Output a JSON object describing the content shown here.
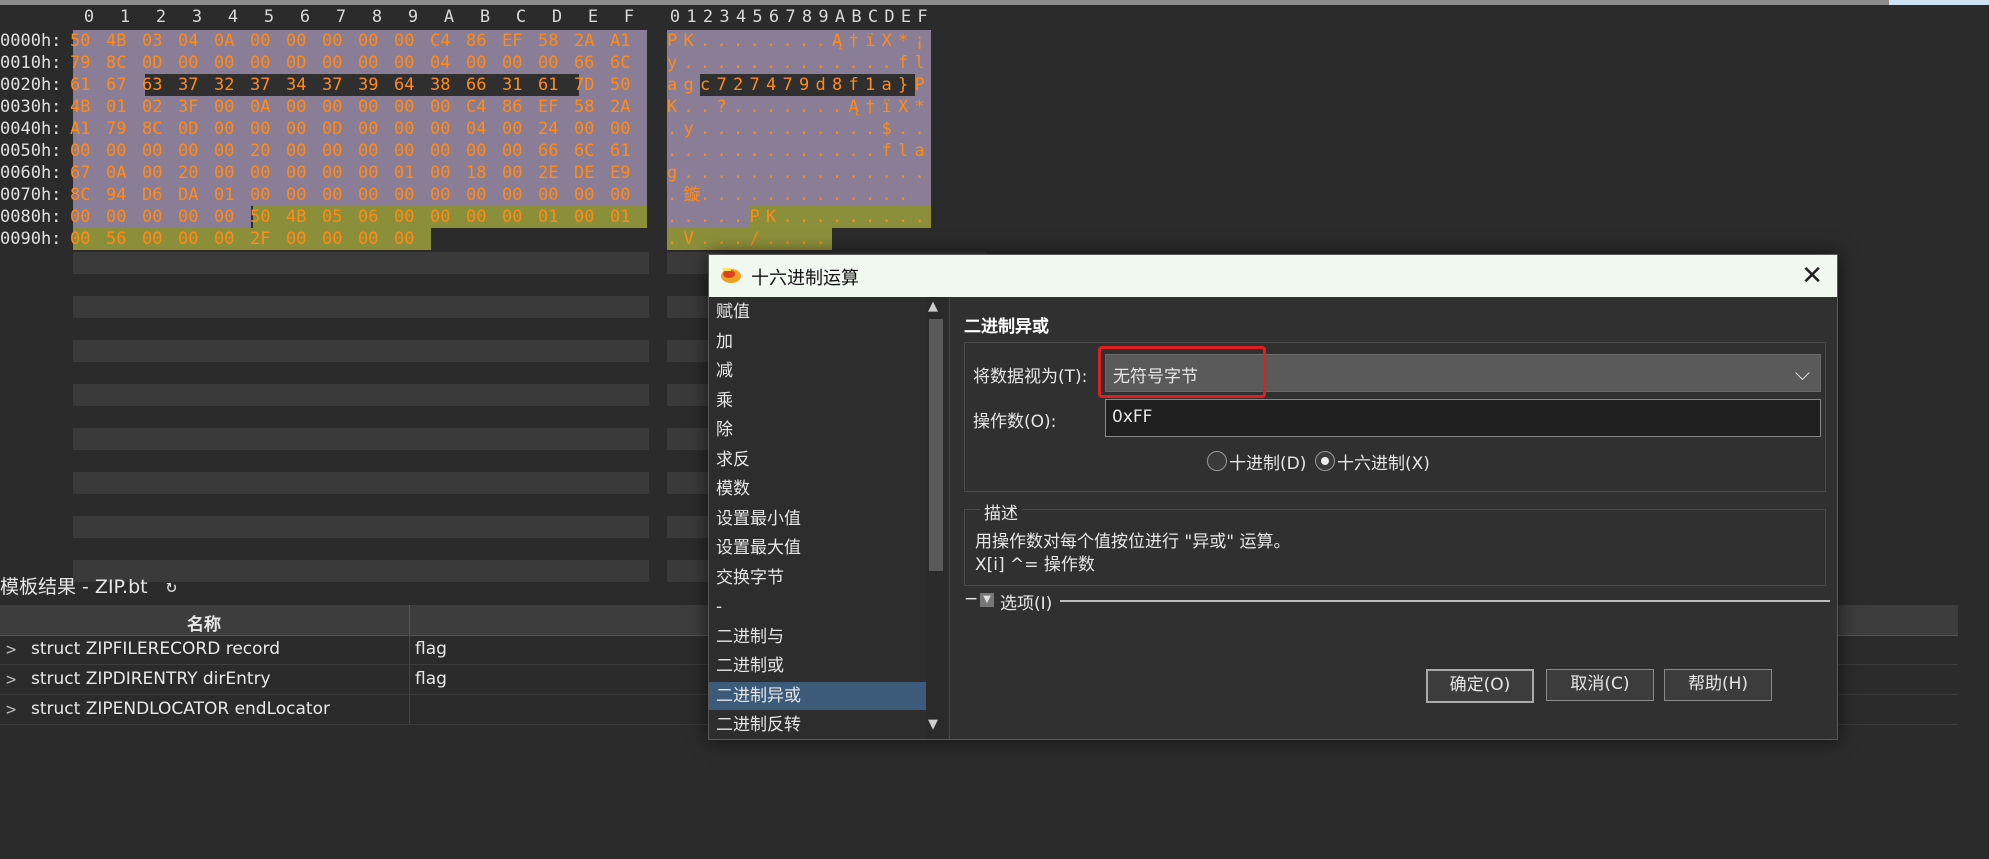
{
  "hex_editor": {
    "hex_header": [
      "0",
      "1",
      "2",
      "3",
      "4",
      "5",
      "6",
      "7",
      "8",
      "9",
      "A",
      "B",
      "C",
      "D",
      "E",
      "F"
    ],
    "ascii_header": [
      "0",
      "1",
      "2",
      "3",
      "4",
      "5",
      "6",
      "7",
      "8",
      "9",
      "A",
      "B",
      "C",
      "D",
      "E",
      "F"
    ],
    "rows": [
      {
        "addr": "0000h:",
        "bytes": [
          "50",
          "4B",
          "03",
          "04",
          "0A",
          "00",
          "00",
          "00",
          "00",
          "00",
          "C4",
          "86",
          "EF",
          "58",
          "2A",
          "A1"
        ],
        "ascii": "P K . . . . . . . . Ą † ï X * ¡"
      },
      {
        "addr": "0010h:",
        "bytes": [
          "79",
          "8C",
          "0D",
          "00",
          "00",
          "00",
          "0D",
          "00",
          "00",
          "00",
          "04",
          "00",
          "00",
          "00",
          "66",
          "6C"
        ],
        "ascii": "y . . . . . . . . . . . . . f l"
      },
      {
        "addr": "0020h:",
        "bytes": [
          "61",
          "67",
          "63",
          "37",
          "32",
          "37",
          "34",
          "37",
          "39",
          "64",
          "38",
          "66",
          "31",
          "61",
          "7D",
          "50"
        ],
        "ascii": "a g c 7 2 7 4 7 9 d 8 f 1 a } P"
      },
      {
        "addr": "0030h:",
        "bytes": [
          "4B",
          "01",
          "02",
          "3F",
          "00",
          "0A",
          "00",
          "00",
          "00",
          "00",
          "00",
          "C4",
          "86",
          "EF",
          "58",
          "2A"
        ],
        "ascii": "K . . ? . . . . . . . Ą † ï X *"
      },
      {
        "addr": "0040h:",
        "bytes": [
          "A1",
          "79",
          "8C",
          "0D",
          "00",
          "00",
          "00",
          "0D",
          "00",
          "00",
          "00",
          "04",
          "00",
          "24",
          "00",
          "00"
        ],
        "ascii": ". y . . . . . . . . . . . $ . ."
      },
      {
        "addr": "0050h:",
        "bytes": [
          "00",
          "00",
          "00",
          "00",
          "00",
          "20",
          "00",
          "00",
          "00",
          "00",
          "00",
          "00",
          "00",
          "66",
          "6C",
          "61"
        ],
        "ascii": ". . . . . . . . . . . . . f l a"
      },
      {
        "addr": "0060h:",
        "bytes": [
          "67",
          "0A",
          "00",
          "20",
          "00",
          "00",
          "00",
          "00",
          "00",
          "01",
          "00",
          "18",
          "00",
          "2E",
          "DE",
          "E9"
        ],
        "ascii": "g . . . . . . . . . . . . . . ."
      },
      {
        "addr": "0070h:",
        "bytes": [
          "8C",
          "94",
          "D6",
          "DA",
          "01",
          "00",
          "00",
          "00",
          "00",
          "00",
          "00",
          "00",
          "00",
          "00",
          "00",
          "00"
        ],
        "ascii": ". 鏇 . . . . . . . . . . . . ."
      },
      {
        "addr": "0080h:",
        "bytes": [
          "00",
          "00",
          "00",
          "00",
          "00",
          "50",
          "4B",
          "05",
          "06",
          "00",
          "00",
          "00",
          "00",
          "01",
          "00",
          "01"
        ],
        "ascii": ". . . . . P K . . . . . . . . ."
      },
      {
        "addr": "0090h:",
        "bytes": [
          "00",
          "56",
          "00",
          "00",
          "00",
          "2F",
          "00",
          "00",
          "00",
          "00",
          null,
          null,
          null,
          null,
          null,
          null
        ],
        "ascii": ". V . . . / . . . ."
      }
    ]
  },
  "template_panel": {
    "title": "模板结果 - ZIP.bt",
    "refresh_icon": "↻",
    "col_name": "名称",
    "rows": [
      {
        "name": "struct ZIPFILERECORD record",
        "value": "flag"
      },
      {
        "name": "struct ZIPDIRENTRY dirEntry",
        "value": "flag"
      },
      {
        "name": "struct ZIPENDLOCATOR endLocator",
        "value": ""
      }
    ]
  },
  "dialog": {
    "title": "十六进制运算",
    "close": "✕",
    "operations": [
      "赋值",
      "加",
      "减",
      "乘",
      "除",
      "求反",
      "模数",
      "设置最小值",
      "设置最大值",
      "交换字节",
      "-",
      "二进制与",
      "二进制或",
      "二进制异或",
      "二进制反转"
    ],
    "selected_operation": "二进制异或",
    "section_title": "二进制异或",
    "treat_as_label": "将数据视为(T):",
    "treat_as_value": "无符号字节",
    "operand_label": "操作数(O):",
    "operand_value": "0xFF",
    "radio_decimal": "十进制(D)",
    "radio_hex": "十六进制(X)",
    "radio_selected": "hex",
    "desc_label": "描述",
    "desc_line1": "用操作数对每个值按位进行 \"异或\" 运算。",
    "desc_line2": "X[i] ^= 操作数",
    "options_label": "选项(I)",
    "btn_ok": "确定(O)",
    "btn_cancel": "取消(C)",
    "btn_help": "帮助(H)"
  },
  "colors": {
    "hex_text": "#ff8c1a",
    "purple_block": "#8a7d96",
    "olive_block": "#8c8f3a",
    "highlight_red": "#e02020",
    "selection": "#3c5a7a"
  }
}
